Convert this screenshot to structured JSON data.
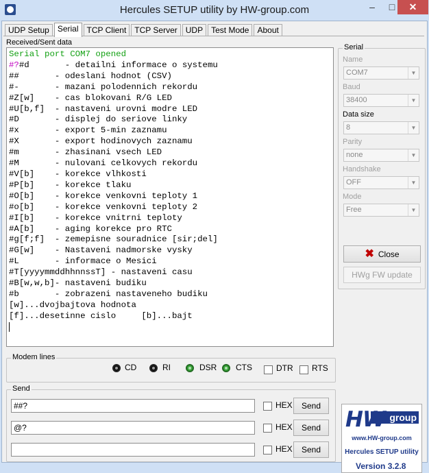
{
  "window": {
    "title": "Hercules SETUP utility by HW-group.com",
    "min": "–",
    "max": "□",
    "close": "✕"
  },
  "tabs": [
    "UDP Setup",
    "Serial",
    "TCP Client",
    "TCP Server",
    "UDP",
    "Test Mode",
    "About"
  ],
  "received": {
    "label": "Received/Sent data",
    "lines": [
      {
        "text": "Serial port COM7 opened",
        "color": "green"
      },
      {
        "prefix": "#?",
        "text": "#d       - detailni informace o systemu"
      },
      {
        "text": "##       - odeslani hodnot (CSV)"
      },
      {
        "text": "#-       - mazani polodennich rekordu"
      },
      {
        "text": "#Z[w]    - cas blokovani R/G LED"
      },
      {
        "text": "#U[b,f]  - nastaveni urovni modre LED"
      },
      {
        "text": "#D       - displej do seriove linky"
      },
      {
        "text": "#x       - export 5-min zaznamu"
      },
      {
        "text": "#X       - export hodinovych zaznamu"
      },
      {
        "text": "#m       - zhasinani vsech LED"
      },
      {
        "text": "#M       - nulovani celkovych rekordu"
      },
      {
        "text": "#V[b]    - korekce vlhkosti"
      },
      {
        "text": "#P[b]    - korekce tlaku"
      },
      {
        "text": "#O[b]    - korekce venkovni teploty 1"
      },
      {
        "text": "#o[b]    - korekce venkovni teploty 2"
      },
      {
        "text": "#I[b]    - korekce vnitrni teploty"
      },
      {
        "text": "#A[b]    - aging korekce pro RTC"
      },
      {
        "text": "#g[f;f]  - zemepisne souradnice [sir;del]"
      },
      {
        "text": "#G[w]    - Nastaveni nadmorske vysky"
      },
      {
        "text": "#L       - informace o Mesici"
      },
      {
        "text": "#T[yyyymmddhhnnssT] - nastaveni casu"
      },
      {
        "text": "#B[w,w,b]- nastaveni budiku"
      },
      {
        "text": "#b       - zobrazeni nastaveneho budiku"
      },
      {
        "text": "[w]...dvojbajtova hodnota"
      },
      {
        "text": "[f]...desetinne cislo     [b]...bajt"
      }
    ]
  },
  "serial": {
    "title": "Serial",
    "name_label": "Name",
    "name_value": "COM7",
    "baud_label": "Baud",
    "baud_value": "38400",
    "datasize_label": "Data size",
    "datasize_value": "8",
    "parity_label": "Parity",
    "parity_value": "none",
    "handshake_label": "Handshake",
    "handshake_value": "OFF",
    "mode_label": "Mode",
    "mode_value": "Free",
    "close_button": "Close",
    "fw_button": "HWg FW update"
  },
  "modem": {
    "title": "Modem lines",
    "leds": [
      {
        "label": "CD",
        "state": "off"
      },
      {
        "label": "RI",
        "state": "off"
      },
      {
        "label": "DSR",
        "state": "on"
      },
      {
        "label": "CTS",
        "state": "on"
      }
    ],
    "checks": [
      {
        "label": "DTR",
        "checked": false
      },
      {
        "label": "RTS",
        "checked": false
      }
    ]
  },
  "send": {
    "title": "Send",
    "rows": [
      {
        "value": "##?",
        "hex_label": "HEX",
        "button": "Send"
      },
      {
        "value": "@?",
        "hex_label": "HEX",
        "button": "Send"
      },
      {
        "value": "",
        "hex_label": "HEX",
        "button": "Send"
      }
    ]
  },
  "logo": {
    "brand_hw": "HW",
    "brand_group": "group",
    "url": "www.HW-group.com",
    "app": "Hercules SETUP utility",
    "version": "Version  3.2.8"
  },
  "colors": {
    "accent": "#1f3a8a",
    "green_text": "#13a013",
    "close_red": "#c75050",
    "led_on": "#3aa83a"
  }
}
